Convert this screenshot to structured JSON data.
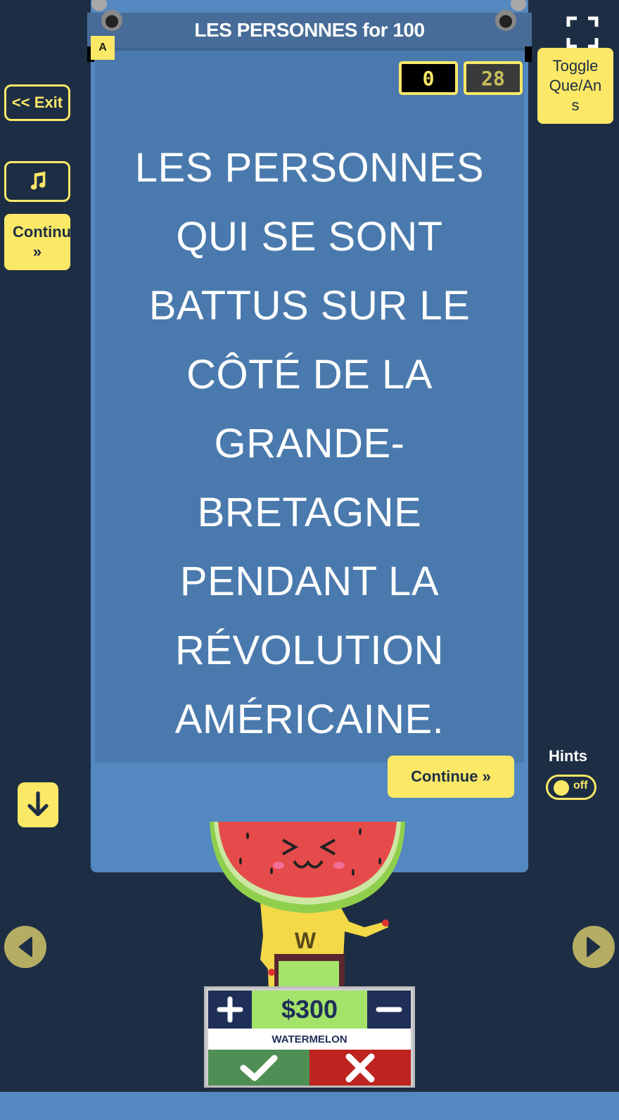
{
  "header": {
    "title": "LES PERSONNES for 100",
    "team_tag": "A"
  },
  "scores": {
    "points": "0",
    "timer": "28"
  },
  "question": {
    "text": "LES PERSONNES QUI SE SONT BATTUS SUR LE CÔTÉ DE LA GRANDE-BRETAGNE PENDANT LA RÉVOLUTION AMÉRICAINE."
  },
  "left_panel": {
    "exit_label": "<< Exit",
    "continue_label": "Continue »"
  },
  "right_panel": {
    "toggle_label": "Toggle Que/Ans",
    "hints_label": "Hints",
    "hints_state": "off"
  },
  "main": {
    "continue_label": "Continue »"
  },
  "player": {
    "amount": "$300",
    "name": "WATERMELON",
    "shirt_letter": "W"
  },
  "icons": {
    "music": "music-note-icon",
    "fullscreen": "fullscreen-icon",
    "down": "arrow-down-icon",
    "prev": "triangle-left-icon",
    "next": "triangle-right-icon",
    "plus": "plus-icon",
    "minus": "minus-icon",
    "check": "checkmark-icon",
    "cross": "cross-icon"
  },
  "colors": {
    "background": "#1d2e44",
    "card": "#5488c0",
    "accent_yellow": "#fbe867",
    "correct_green": "#4f8e54",
    "wrong_red": "#bd231f",
    "money_green": "#a4e36a"
  }
}
